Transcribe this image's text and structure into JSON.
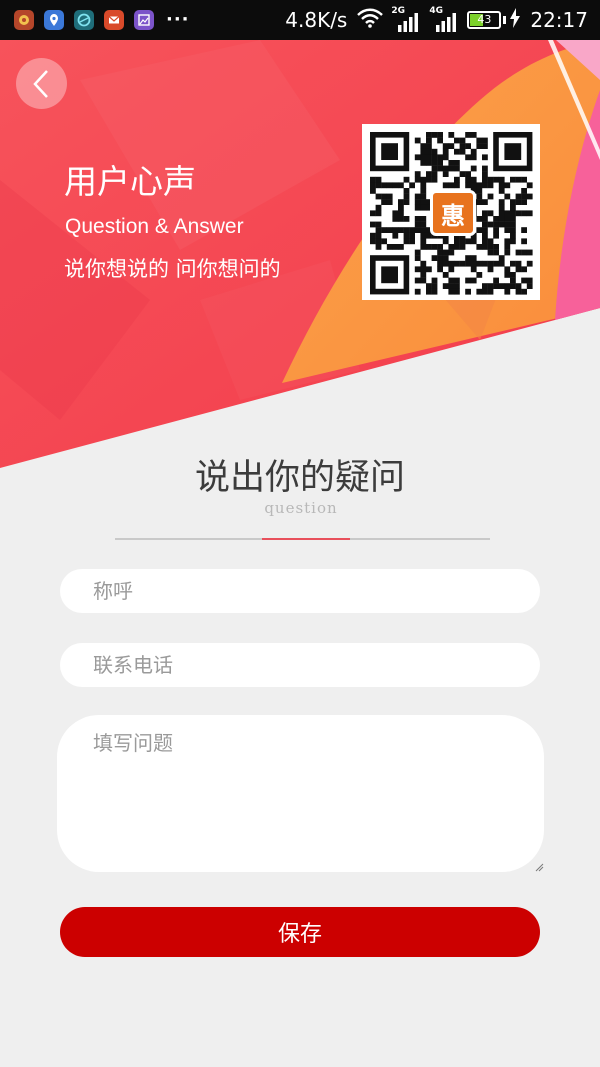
{
  "status_bar": {
    "speed": "4.8K/s",
    "network_1": "2G",
    "network_2": "4G",
    "battery": "43",
    "time": "22:17",
    "more": "···",
    "app_icons": [
      "app-badge-icon",
      "location-app-icon",
      "browser-app-icon",
      "mail-app-icon",
      "gallery-app-icon"
    ]
  },
  "hero": {
    "title": "用户心声",
    "subtitle_en": "Question & Answer",
    "slogan": "说你想说的 问你想问的",
    "qr_badge": "惠",
    "colors": {
      "red": "#f4424f",
      "orange": "#fb9f47",
      "pink": "#f7619a"
    }
  },
  "section": {
    "title": "说出你的疑问",
    "subtitle": "question"
  },
  "form": {
    "name_placeholder": "称呼",
    "phone_placeholder": "联系电话",
    "question_placeholder": "填写问题",
    "save_label": "保存"
  },
  "colors": {
    "save_button": "#cc0000",
    "background": "#efefef",
    "accent_line": "#e8505b"
  }
}
